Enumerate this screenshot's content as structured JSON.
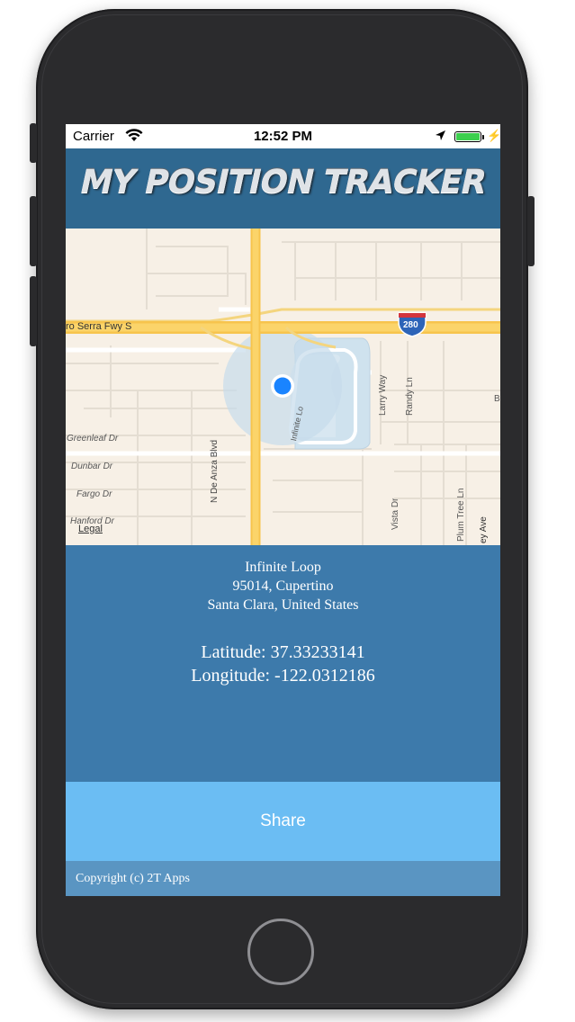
{
  "status_bar": {
    "carrier": "Carrier",
    "time": "12:52 PM",
    "battery_color": "#3ccf4e"
  },
  "header": {
    "title": "MY POSITION TRACKER",
    "background": "#2f6890"
  },
  "map": {
    "road_labels": {
      "freeway": "ro Serra Fwy S",
      "interstate_shield": "280",
      "de_anza": "N De Anza Blvd",
      "infinite_loop": "Infinite Lo",
      "larry_way": "Larry Way",
      "randy_ln": "Randy Ln",
      "greenleaf": "Greenleaf Dr",
      "dunbar": "Dunbar Dr",
      "fargo": "Fargo Dr",
      "hanford": "Hanford Dr",
      "vista": "Vista Dr",
      "plum_tree": "Plum Tree Ln",
      "ey_ave": "ey Ave",
      "edge_b": "B"
    },
    "legal_label": "Legal"
  },
  "address": {
    "line1": "Infinite Loop",
    "line2": "95014, Cupertino",
    "line3": "Santa Clara, United States"
  },
  "coordinates": {
    "latitude_text": "Latitude: 37.33233141",
    "longitude_text": "Longitude: -122.0312186"
  },
  "share": {
    "label": "Share",
    "color": "#6bbdf3"
  },
  "footer": {
    "copyright": "Copyright (c) 2T Apps"
  }
}
